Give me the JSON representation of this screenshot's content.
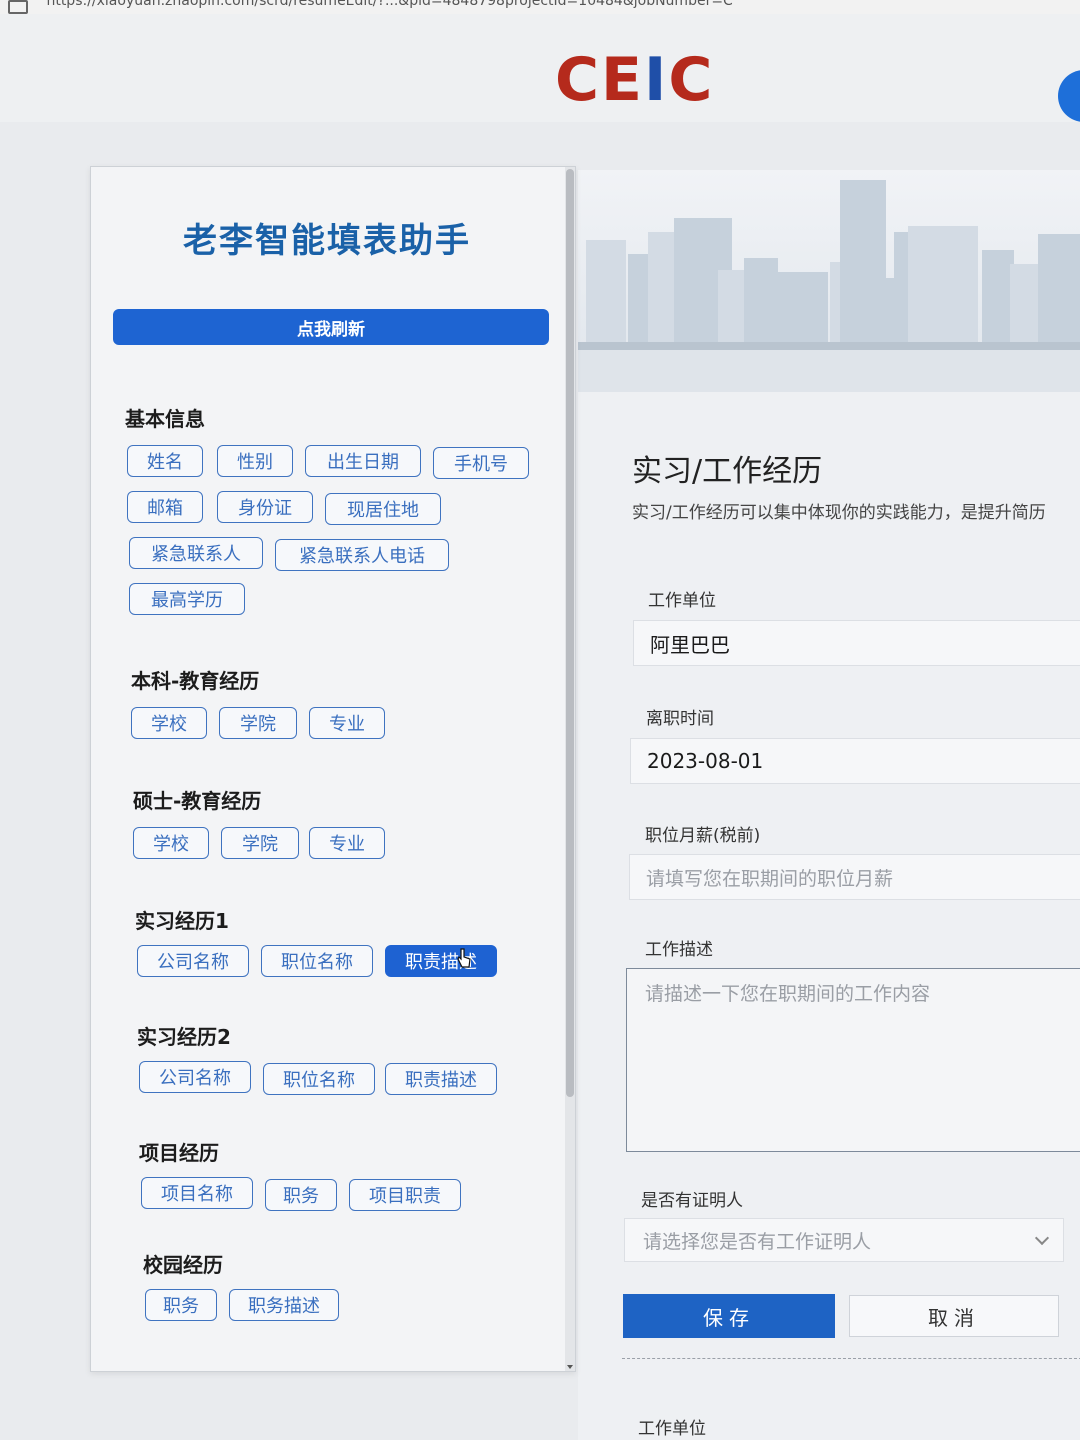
{
  "browser": {
    "url": "https://xiaoyuan.zhaopin.com/scrd/resumeEdit/?...&pid=4848798projectId=10484&jobNumber=C"
  },
  "header": {
    "logo_main": "CE",
    "logo_accent": "I",
    "logo_end": "C"
  },
  "helper": {
    "title": "老李智能填表助手",
    "refresh_label": "点我刷新",
    "groups": [
      {
        "title": "基本信息",
        "chips": [
          "姓名",
          "性别",
          "出生日期",
          "手机号",
          "邮箱",
          "身份证",
          "现居住地",
          "紧急联系人",
          "紧急联系人电话",
          "最高学历"
        ]
      },
      {
        "title": "本科-教育经历",
        "chips": [
          "学校",
          "学院",
          "专业"
        ]
      },
      {
        "title": "硕士-教育经历",
        "chips": [
          "学校",
          "学院",
          "专业"
        ]
      },
      {
        "title": "实习经历1",
        "chips": [
          "公司名称",
          "职位名称",
          "职责描述"
        ],
        "active_index": 2
      },
      {
        "title": "实习经历2",
        "chips": [
          "公司名称",
          "职位名称",
          "职责描述"
        ]
      },
      {
        "title": "项目经历",
        "chips": [
          "项目名称",
          "职务",
          "项目职责"
        ]
      },
      {
        "title": "校园经历",
        "chips": [
          "职务",
          "职务描述"
        ]
      }
    ]
  },
  "form": {
    "section_title": "实习/工作经历",
    "section_desc": "实习/工作经历可以集中体现你的实践能力，是提升简历",
    "company_label": "工作单位",
    "company_value": "阿里巴巴",
    "leave_label": "离职时间",
    "leave_value": "2023-08-01",
    "salary_label": "职位月薪(税前)",
    "salary_placeholder": "请填写您在职期间的职位月薪",
    "desc_label": "工作描述",
    "desc_placeholder": "请描述一下您在职期间的工作内容",
    "witness_label": "是否有证明人",
    "witness_placeholder": "请选择您是否有工作证明人",
    "save_label": "保存",
    "cancel_label": "取消",
    "next_company_label": "工作单位"
  },
  "colors": {
    "primary": "#1e63c4",
    "logo_red": "#b52a1c",
    "title_blue": "#1a61a8"
  }
}
